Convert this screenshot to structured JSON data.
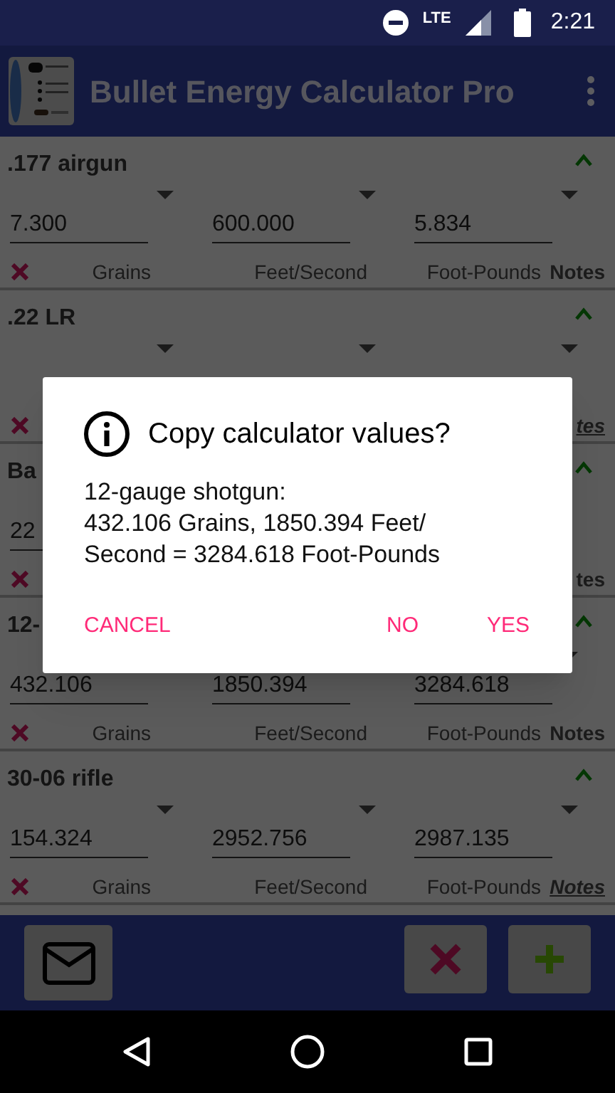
{
  "status_bar": {
    "network": "LTE",
    "time": "2:21"
  },
  "app_bar": {
    "title": "Bullet Energy Calculator Pro"
  },
  "cards": [
    {
      "name": ".177 airgun",
      "fields": [
        {
          "value": "7.300",
          "unit": "Grains"
        },
        {
          "value": "600.000",
          "unit": "Feet/Second"
        },
        {
          "value": "5.834",
          "unit": "Foot-Pounds"
        }
      ],
      "notes": "Notes",
      "notes_linked": false
    },
    {
      "name": ".22 LR",
      "notes": "tes",
      "notes_linked": true
    },
    {
      "name": "Ba",
      "fields": [
        {
          "value": "22"
        }
      ],
      "notes": "tes",
      "notes_linked": false
    },
    {
      "name": "12-",
      "fields": [
        {
          "value": "432.106",
          "unit": "Grains"
        },
        {
          "value": "1850.394",
          "unit": "Feet/Second"
        },
        {
          "value": "3284.618",
          "unit": "Foot-Pounds"
        }
      ],
      "notes": "Notes",
      "notes_linked": false
    },
    {
      "name": "30-06 rifle",
      "fields": [
        {
          "value": "154.324",
          "unit": "Grains"
        },
        {
          "value": "2952.756",
          "unit": "Feet/Second"
        },
        {
          "value": "2987.135",
          "unit": "Foot-Pounds"
        }
      ],
      "notes": "Notes",
      "notes_linked": true
    }
  ],
  "dialog": {
    "title": "Copy calculator values?",
    "message": "12-gauge shotgun:\n432.106 Grains, 1850.394 Feet/\nSecond = 3284.618 Foot-Pounds",
    "buttons": [
      "CANCEL",
      "NO",
      "YES"
    ]
  }
}
